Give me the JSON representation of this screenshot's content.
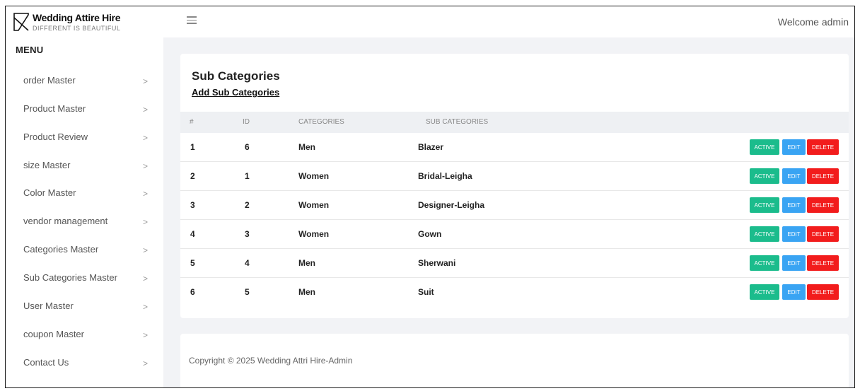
{
  "brand": {
    "title": "Wedding Attire Hire",
    "tagline": "DIFFERENT IS BEAUTIFUL"
  },
  "header": {
    "welcome": "Welcome admin"
  },
  "sidebar": {
    "menu_title": "MENU",
    "items": [
      {
        "label": "order Master"
      },
      {
        "label": "Product Master"
      },
      {
        "label": "Product Review"
      },
      {
        "label": "size Master"
      },
      {
        "label": "Color Master"
      },
      {
        "label": "vendor management"
      },
      {
        "label": "Categories Master"
      },
      {
        "label": "Sub Categories Master"
      },
      {
        "label": "User Master"
      },
      {
        "label": "coupon Master"
      },
      {
        "label": "Contact Us"
      }
    ]
  },
  "main": {
    "title": "Sub Categories",
    "add_link": "Add Sub Categories",
    "columns": [
      "#",
      "ID",
      "CATEGORIES",
      "SUB CATEGORIES"
    ],
    "actions": {
      "active": "ACTIVE",
      "edit": "EDIT",
      "delete": "DELETE"
    },
    "rows": [
      {
        "num": "1",
        "id": "6",
        "category": "Men",
        "sub": "Blazer"
      },
      {
        "num": "2",
        "id": "1",
        "category": "Women",
        "sub": "Bridal-Leigha"
      },
      {
        "num": "3",
        "id": "2",
        "category": "Women",
        "sub": "Designer-Leigha"
      },
      {
        "num": "4",
        "id": "3",
        "category": "Women",
        "sub": "Gown"
      },
      {
        "num": "5",
        "id": "4",
        "category": "Men",
        "sub": "Sherwani"
      },
      {
        "num": "6",
        "id": "5",
        "category": "Men",
        "sub": "Suit"
      }
    ]
  },
  "footer": {
    "copyright": "Copyright © 2025 Wedding Attri Hire-Admin"
  },
  "colors": {
    "active": "#1bbc8c",
    "edit": "#39a4f3",
    "delete": "#f21c1c"
  }
}
